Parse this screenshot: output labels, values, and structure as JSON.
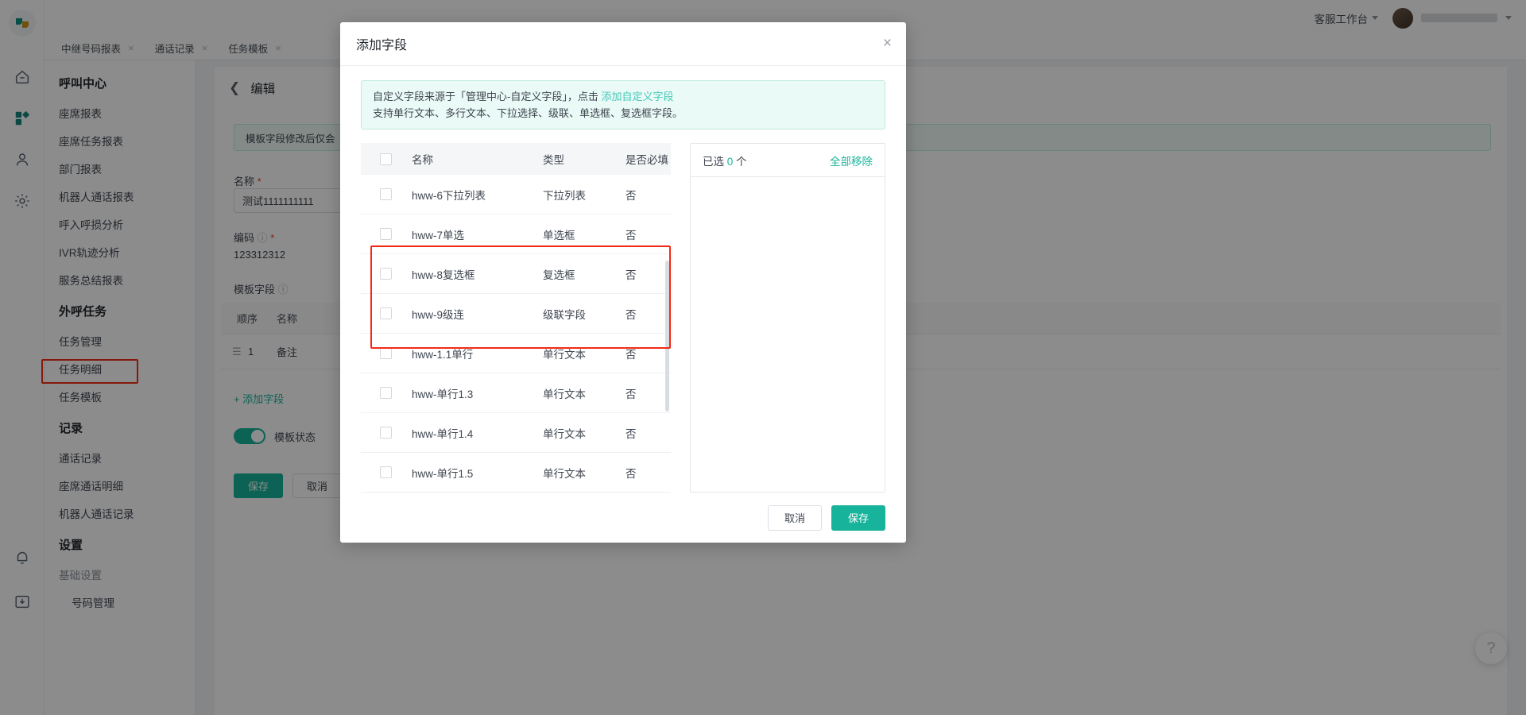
{
  "topbar": {
    "workbench_label": "客服工作台",
    "user_name": ""
  },
  "tabs": [
    {
      "label": "中继号码报表",
      "close": "×"
    },
    {
      "label": "通话记录",
      "close": "×"
    },
    {
      "label": "任务模板",
      "close": "×"
    }
  ],
  "sidebar": {
    "groups": [
      {
        "title": "呼叫中心",
        "items": [
          {
            "label": "座席报表"
          },
          {
            "label": "座席任务报表"
          },
          {
            "label": "部门报表"
          },
          {
            "label": "机器人通话报表"
          },
          {
            "label": "呼入呼损分析"
          },
          {
            "label": "IVR轨迹分析"
          },
          {
            "label": "服务总结报表"
          }
        ]
      },
      {
        "title": "外呼任务",
        "items": [
          {
            "label": "任务管理"
          },
          {
            "label": "任务明细"
          },
          {
            "label": "任务模板",
            "highlighted": true
          }
        ]
      },
      {
        "title": "记录",
        "items": [
          {
            "label": "通话记录"
          },
          {
            "label": "座席通话明细"
          },
          {
            "label": "机器人通话记录"
          }
        ]
      },
      {
        "title": "设置",
        "items": [
          {
            "label": "基础设置",
            "muted": true
          },
          {
            "label": "号码管理",
            "indent": true
          }
        ]
      }
    ]
  },
  "page": {
    "breadcrumb_title": "编辑",
    "notice": "模板字段修改后仅会",
    "name_label": "名称",
    "name_value": "测试1111111111",
    "code_label": "编码",
    "code_value": "123312312",
    "template_fields_label": "模板字段",
    "mini_table": {
      "headers": [
        "顺序",
        "名称"
      ],
      "rows": [
        {
          "order": "1",
          "name": "备注"
        }
      ]
    },
    "add_field_label": "添加字段",
    "switch_label": "模板状态",
    "save_label": "保存",
    "cancel_label": "取消",
    "help_icon": "?"
  },
  "modal": {
    "title": "添加字段",
    "close_icon": "×",
    "tip_line1_before": "自定义字段来源于「管理中心-自定义字段」，点击 ",
    "tip_link": "添加自定义字段",
    "tip_line2": "支持单行文本、多行文本、下拉选择、级联、单选框、复选框字段。",
    "table": {
      "headers": {
        "name": "名称",
        "type": "类型",
        "required": "是否必填"
      },
      "rows": [
        {
          "name": "hww-6下拉列表",
          "type": "下拉列表",
          "required": "否",
          "checked": false
        },
        {
          "name": "hww-7单选",
          "type": "单选框",
          "required": "否",
          "checked": false
        },
        {
          "name": "hww-8复选框",
          "type": "复选框",
          "required": "否",
          "checked": false
        },
        {
          "name": "hww-9级连",
          "type": "级联字段",
          "required": "否",
          "checked": false
        },
        {
          "name": "hww-1.1单行",
          "type": "单行文本",
          "required": "否",
          "checked": false
        },
        {
          "name": "hww-单行1.3",
          "type": "单行文本",
          "required": "否",
          "checked": false
        },
        {
          "name": "hww-单行1.4",
          "type": "单行文本",
          "required": "否",
          "checked": false
        },
        {
          "name": "hww-单行1.5",
          "type": "单行文本",
          "required": "否",
          "checked": false
        }
      ]
    },
    "selected": {
      "prefix": "已选",
      "count": "0",
      "suffix": "个",
      "clear_all": "全部移除"
    },
    "footer": {
      "cancel": "取消",
      "save": "保存"
    }
  },
  "colors": {
    "accent": "#17b39a",
    "link": "#45c8b8",
    "highlight": "#f42a15",
    "tip_bg": "#eafaf6"
  }
}
